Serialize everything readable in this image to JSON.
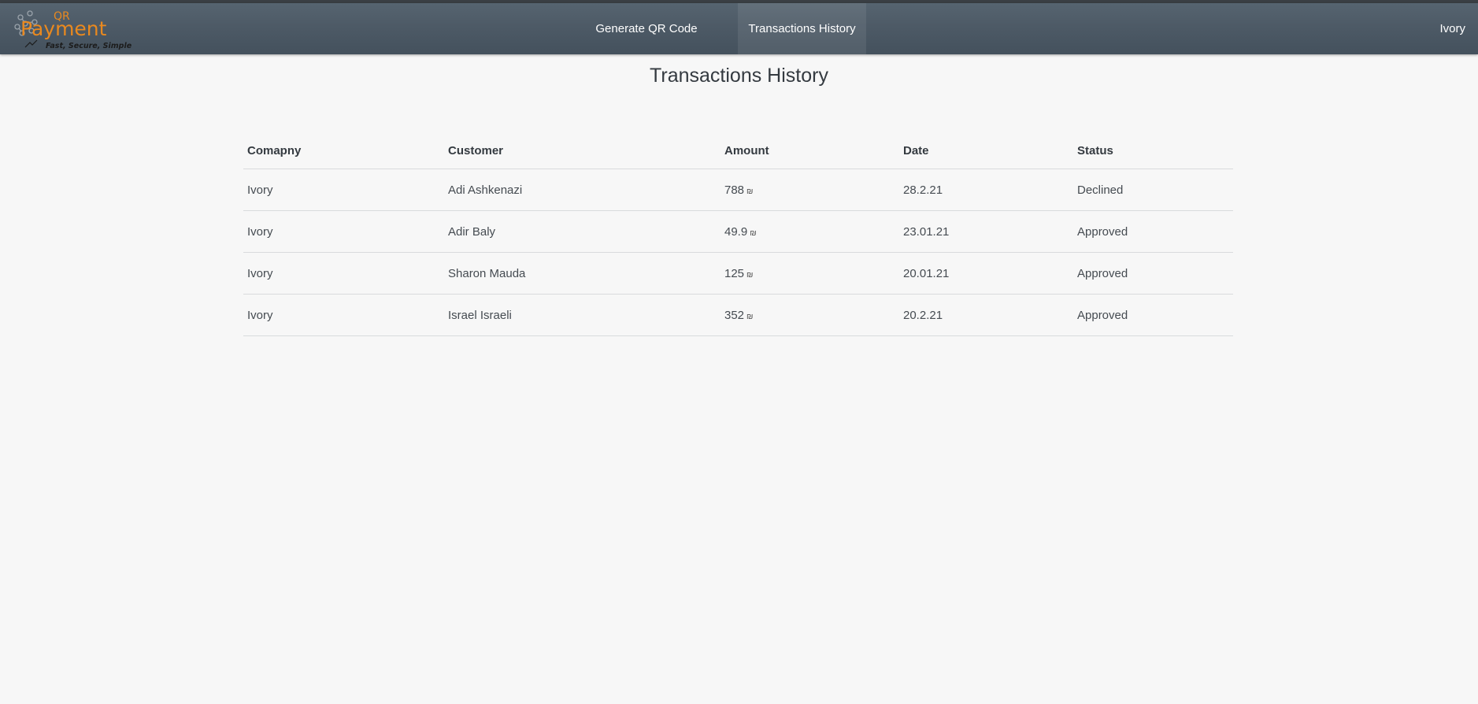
{
  "header": {
    "logo": {
      "line1": "QR",
      "line2": "Payment",
      "tagline": "Fast, Secure, Simple",
      "colors": {
        "orange": "#e9891f",
        "dark": "#1c1c1c"
      }
    },
    "nav": [
      {
        "label": "Generate QR Code",
        "active": false
      },
      {
        "label": "Transactions History",
        "active": true
      }
    ],
    "user": "Ivory"
  },
  "main": {
    "title": "Transactions History",
    "table": {
      "columns": [
        "Comapny",
        "Customer",
        "Amount",
        "Date",
        "Status"
      ],
      "rows": [
        {
          "company": "Ivory",
          "customer": "Adi Ashkenazi",
          "amount": "788",
          "currency": "₪",
          "date": "28.2.21",
          "status": "Declined"
        },
        {
          "company": "Ivory",
          "customer": "Adir Baly",
          "amount": "49.9",
          "currency": "₪",
          "date": "23.01.21",
          "status": "Approved"
        },
        {
          "company": "Ivory",
          "customer": "Sharon Mauda",
          "amount": "125",
          "currency": "₪",
          "date": "20.01.21",
          "status": "Approved"
        },
        {
          "company": "Ivory",
          "customer": "Israel Israeli",
          "amount": "352",
          "currency": "₪",
          "date": "20.2.21",
          "status": "Approved"
        }
      ]
    }
  }
}
